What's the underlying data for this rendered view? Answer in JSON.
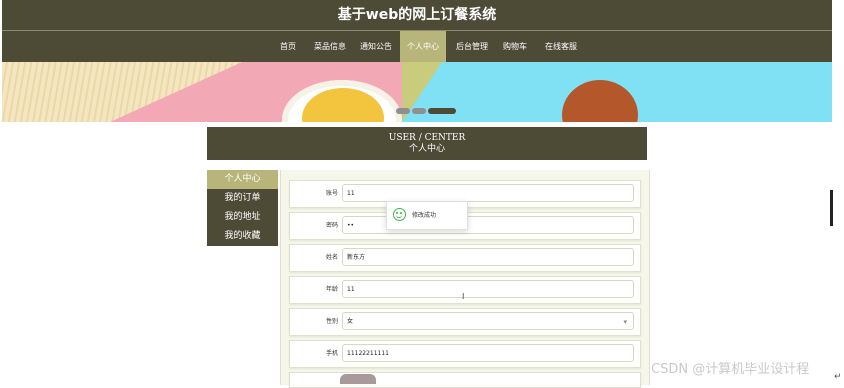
{
  "app": {
    "title": "基于web的网上订餐系统"
  },
  "nav": {
    "items": [
      {
        "label": "首页",
        "active": false
      },
      {
        "label": "菜品信息",
        "active": false
      },
      {
        "label": "通知公告",
        "active": false
      },
      {
        "label": "个人中心",
        "active": true
      },
      {
        "label": "后台管理",
        "active": false
      },
      {
        "label": "购物车",
        "active": false
      },
      {
        "label": "在线客服",
        "active": false
      }
    ]
  },
  "banner": {
    "dots": 3,
    "active_dot": 3
  },
  "section": {
    "title_en": "USER / CENTER",
    "title_cn": "个人中心"
  },
  "sidebar": {
    "items": [
      {
        "label": "个人中心",
        "active": true
      },
      {
        "label": "我的订单",
        "active": false
      },
      {
        "label": "我的地址",
        "active": false
      },
      {
        "label": "我的收藏",
        "active": false
      }
    ]
  },
  "form": {
    "rows": [
      {
        "label": "账号",
        "value": "11"
      },
      {
        "label": "密码",
        "value": "••"
      },
      {
        "label": "姓名",
        "value": "新东方"
      },
      {
        "label": "年龄",
        "value": "11"
      },
      {
        "label": "性别",
        "value": "女"
      },
      {
        "label": "手机",
        "value": "11122211111"
      }
    ]
  },
  "toast": {
    "message": "修改成功",
    "icon": "smile-icon"
  },
  "watermark": "CSDN @计算机毕业设计程"
}
